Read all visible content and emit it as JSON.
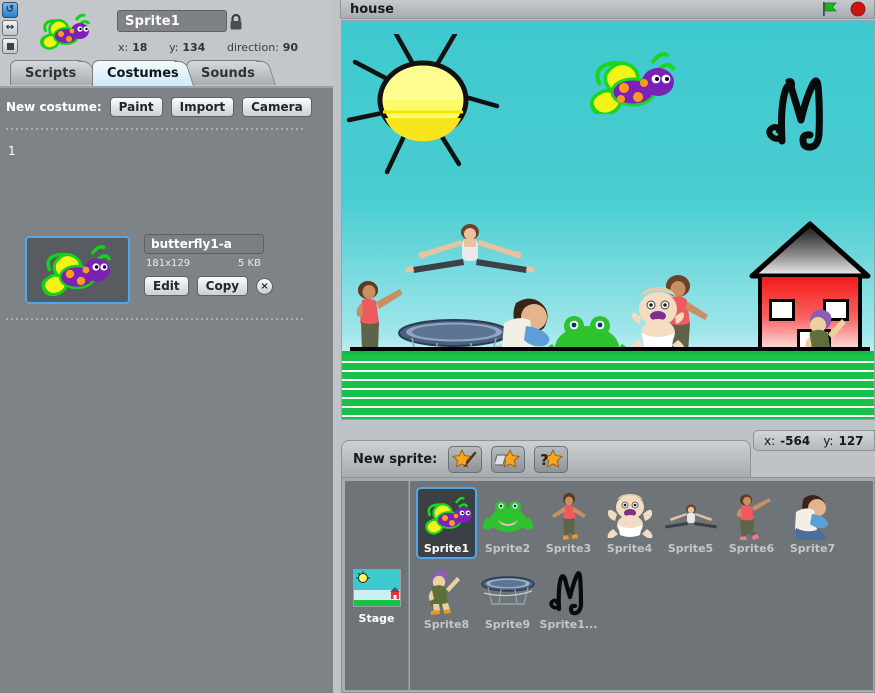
{
  "rotation_buttons": [
    {
      "name": "rotate-all-around",
      "selected": true
    },
    {
      "name": "rotate-left-right",
      "selected": false
    },
    {
      "name": "rotate-none",
      "selected": false
    }
  ],
  "sprite_header": {
    "name_value": "Sprite1",
    "lock_icon": "lock-icon",
    "x_label": "x:",
    "x_value": "18",
    "y_label": "y:",
    "y_value": "134",
    "direction_label": "direction:",
    "direction_value": "90"
  },
  "tabs": [
    {
      "label": "Scripts",
      "active": false
    },
    {
      "label": "Costumes",
      "active": true
    },
    {
      "label": "Sounds",
      "active": false
    }
  ],
  "costumes_panel": {
    "new_costume_label": "New costume:",
    "buttons": [
      {
        "label": "Paint",
        "name": "paint-costume-button"
      },
      {
        "label": "Import",
        "name": "import-costume-button"
      },
      {
        "label": "Camera",
        "name": "camera-costume-button"
      }
    ],
    "costume": {
      "index": "1",
      "name": "butterfly1-a",
      "dimensions": "181x129",
      "filesize": "5 KB",
      "edit_label": "Edit",
      "copy_label": "Copy",
      "delete_label": "×"
    }
  },
  "stage_header": {
    "project_title": "house",
    "green_flag_icon": "green-flag-icon",
    "stop_icon": "stop-sign-icon"
  },
  "stage": {
    "backdrop_name": "house-backdrop",
    "mouse_x_label": "x:",
    "mouse_x_value": "-564",
    "mouse_y_label": "y:",
    "mouse_y_value": "127"
  },
  "new_sprite_bar": {
    "label": "New sprite:",
    "buttons": [
      {
        "name": "paint-new-sprite-button",
        "icon": "star-paintbrush-icon"
      },
      {
        "name": "import-sprite-button",
        "icon": "star-folder-icon"
      },
      {
        "name": "surprise-sprite-button",
        "icon": "star-question-icon"
      }
    ]
  },
  "sprite_list": {
    "stage_label": "Stage",
    "sprites": [
      {
        "label": "Sprite1",
        "art": "butterfly",
        "selected": true
      },
      {
        "label": "Sprite2",
        "art": "frog",
        "selected": false
      },
      {
        "label": "Sprite3",
        "art": "girl-arms",
        "selected": false
      },
      {
        "label": "Sprite4",
        "art": "baby",
        "selected": false
      },
      {
        "label": "Sprite5",
        "art": "splits",
        "selected": false
      },
      {
        "label": "Sprite6",
        "art": "girl-point",
        "selected": false
      },
      {
        "label": "Sprite7",
        "art": "girl-crouch",
        "selected": false
      },
      {
        "label": "Sprite8",
        "art": "woman-wave",
        "selected": false
      },
      {
        "label": "Sprite9",
        "art": "trampoline",
        "selected": false
      },
      {
        "label": "Sprite1...",
        "art": "letter-m",
        "selected": false
      }
    ]
  },
  "colors": {
    "panel_gray": "#7e8387",
    "chrome_gray": "#bfc3c7",
    "selection_blue": "#4fa8e8",
    "sky_cyan": "#3ec9ce",
    "grass_green": "#18c24a",
    "house_red": "#f31a1a",
    "flag_green": "#21b21f",
    "stop_red": "#cc1414"
  }
}
